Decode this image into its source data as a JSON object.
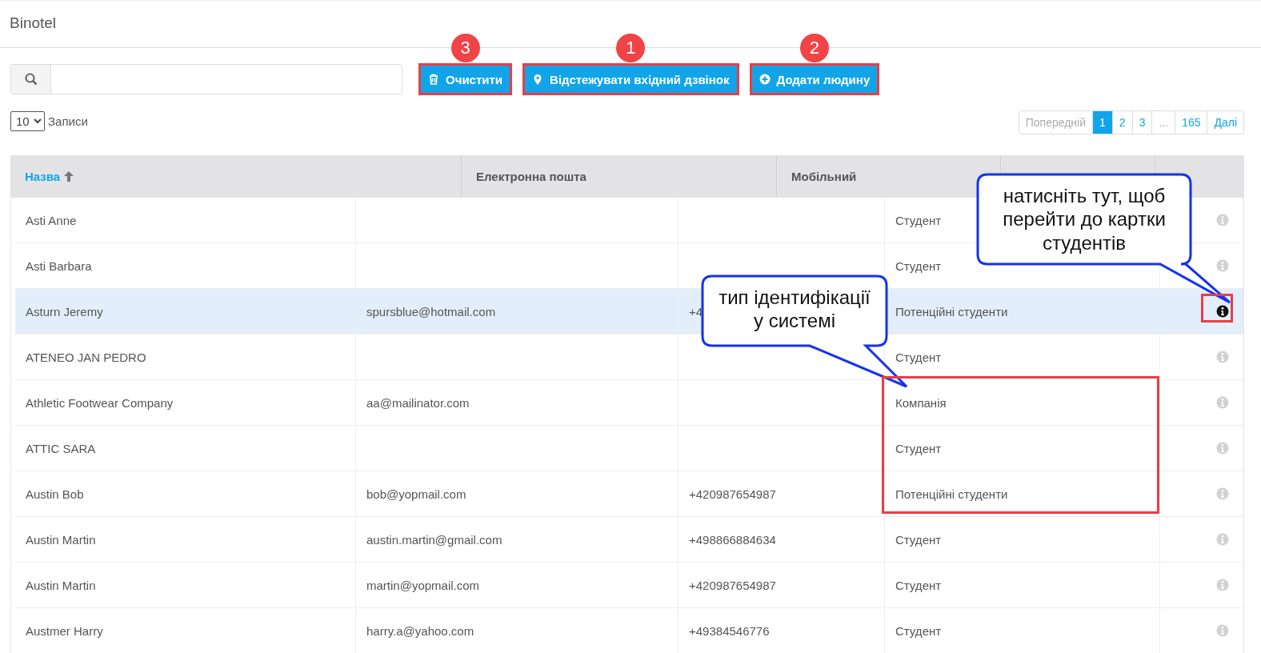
{
  "app": {
    "title": "Binotel"
  },
  "buttons": [
    {
      "label": "Очистити",
      "kind": "trash",
      "marker": "3",
      "highlighted": true
    },
    {
      "label": "Відстежувати вхідний дзвінок",
      "kind": "pin",
      "marker": "1",
      "highlighted": true
    },
    {
      "label": "Додати людину",
      "kind": "plus",
      "marker": "2",
      "highlighted": true
    }
  ],
  "page_size": {
    "value": "10",
    "label": "Записи"
  },
  "pagination": [
    {
      "label": "Попередній",
      "disabled": true,
      "selected": false
    },
    {
      "label": "1",
      "disabled": false,
      "selected": true
    },
    {
      "label": "2",
      "disabled": false,
      "selected": false
    },
    {
      "label": "3",
      "disabled": false,
      "selected": false
    },
    {
      "label": "...",
      "disabled": true,
      "selected": false
    },
    {
      "label": "165",
      "disabled": false,
      "selected": false
    },
    {
      "label": "Далі",
      "disabled": false,
      "selected": false
    }
  ],
  "table": {
    "columns": [
      {
        "label": "Назва",
        "sorted": true
      },
      {
        "label": "Електронна пошта",
        "sorted": false
      },
      {
        "label": "Мобільний",
        "sorted": false
      }
    ],
    "rows": [
      {
        "name": "Asti Anne",
        "email": "",
        "mobile": "",
        "type": "Студент",
        "selected": false
      },
      {
        "name": "Asti Barbara",
        "email": "",
        "mobile": "",
        "type": "Студент",
        "selected": false
      },
      {
        "name": "Asturn Jeremy",
        "email": "spursblue@hotmail.com",
        "mobile": "+4",
        "type": "Потенційні студенти",
        "selected": true
      },
      {
        "name": "ATENEO JAN PEDRO",
        "email": "",
        "mobile": "",
        "type": "Студент",
        "selected": false
      },
      {
        "name": "Athletic Footwear Company",
        "email": "aa@mailinator.com",
        "mobile": "",
        "type": "Компанія",
        "selected": false
      },
      {
        "name": "ATTIC SARA",
        "email": "",
        "mobile": "",
        "type": "Студент",
        "selected": false
      },
      {
        "name": "Austin Bob",
        "email": "bob@yopmail.com",
        "mobile": "+420987654987",
        "type": "Потенційні студенти",
        "selected": false
      },
      {
        "name": "Austin Martin",
        "email": "austin.martin@gmail.com",
        "mobile": "+498866884634",
        "type": "Студент",
        "selected": false
      },
      {
        "name": "Austin Martin",
        "email": "martin@yopmail.com",
        "mobile": "+420987654987",
        "type": "Студент",
        "selected": false
      },
      {
        "name": "Austmer Harry",
        "email": "harry.a@yahoo.com",
        "mobile": "+49384546776",
        "type": "Студент",
        "selected": false
      }
    ]
  },
  "callouts": [
    {
      "text": "натисніть тут, щоб перейти до картки студентів"
    },
    {
      "text": "тип ідентифікації у системі"
    }
  ]
}
